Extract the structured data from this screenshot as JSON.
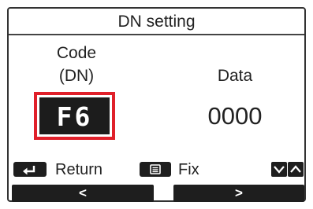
{
  "screen": {
    "title": "DN setting"
  },
  "code": {
    "label_line1": "Code",
    "label_line2": "(DN)",
    "value": "F6",
    "highlight_color": "#e0202a"
  },
  "data": {
    "label": "Data",
    "value": "0000"
  },
  "function_keys": {
    "return_icon": "return-arrow-icon",
    "return_label": "Return",
    "fix_icon": "menu-icon",
    "fix_label": "Fix",
    "scroll_icons": [
      "chevron-down-icon",
      "chevron-up-icon"
    ]
  },
  "nav": {
    "left_label": "<",
    "right_label": ">"
  }
}
